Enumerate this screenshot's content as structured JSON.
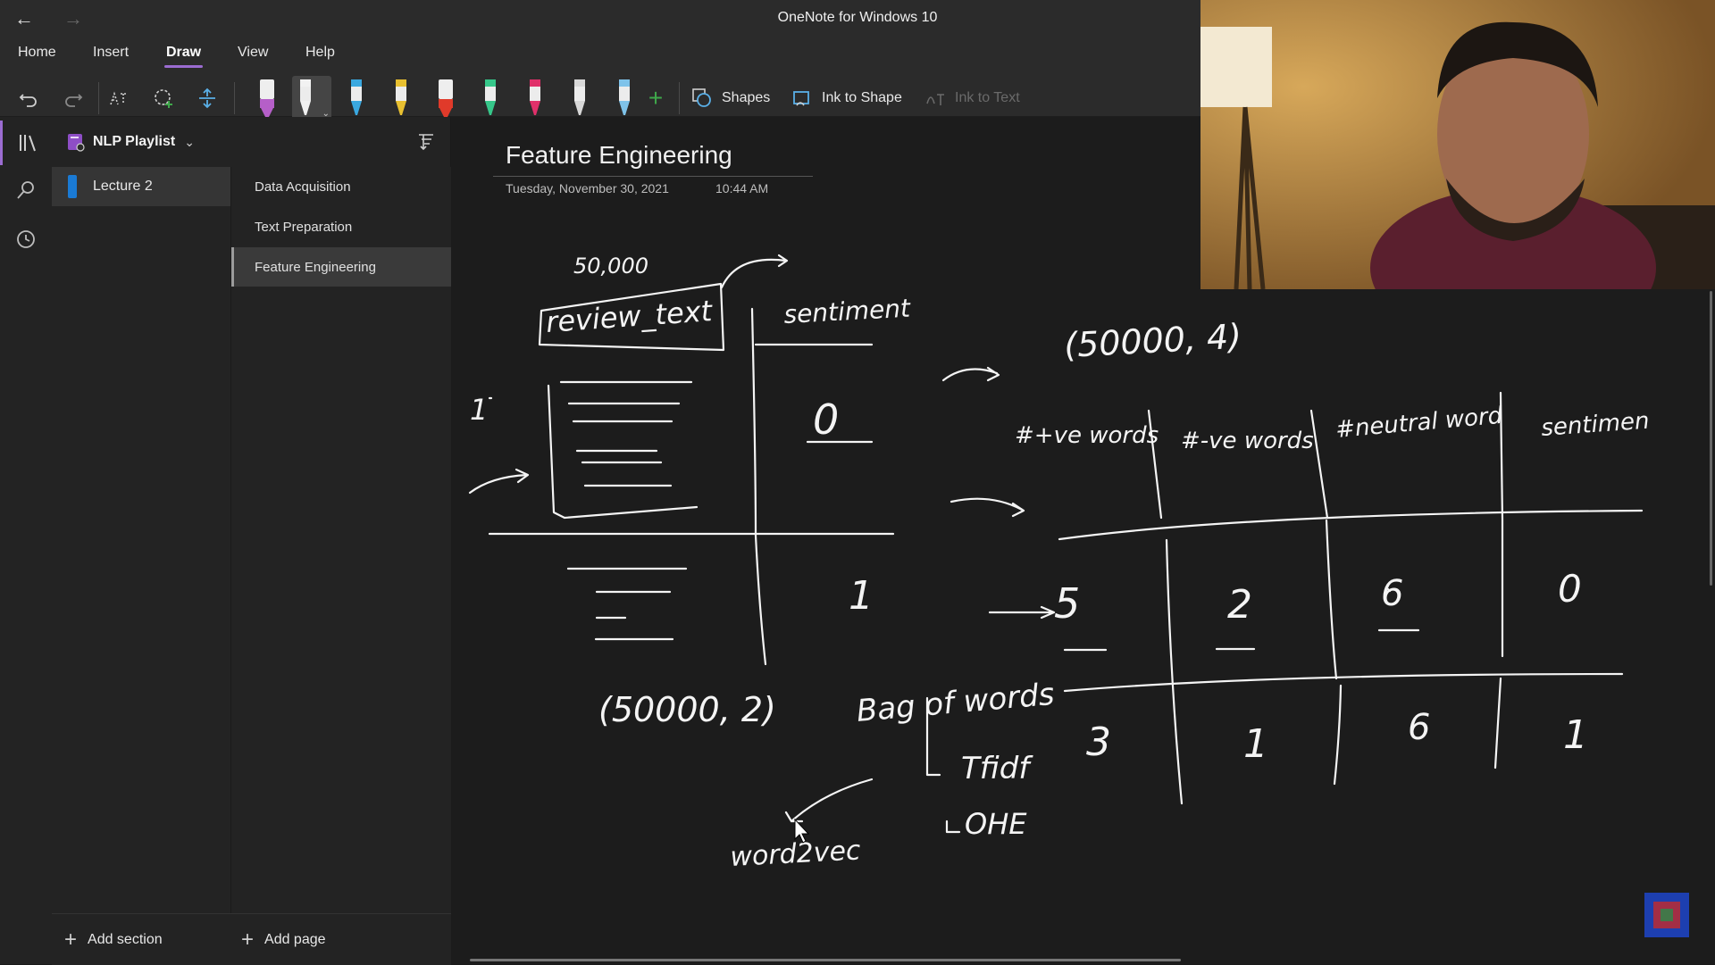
{
  "app": {
    "title": "OneNote for Windows 10"
  },
  "menu": {
    "tabs": [
      "Home",
      "Insert",
      "Draw",
      "View",
      "Help"
    ],
    "active_tab": "Draw"
  },
  "ribbon": {
    "shapes_label": "Shapes",
    "ink_to_shape_label": "Ink to Shape",
    "ink_to_text_label": "Ink to Text",
    "pen_colors": [
      "#b55fc8",
      "#f2f2f2",
      "#3aa8e0",
      "#e8c030",
      "#e03a2a",
      "#36c78a",
      "#e0306a",
      "#d8d8d8",
      "#7fc3ea"
    ],
    "add_pen_color": "#3fa84b"
  },
  "notebook": {
    "name": "NLP Playlist",
    "sections": [
      {
        "label": "Lecture 2",
        "color": "#1a7ad4"
      }
    ],
    "pages": [
      "Data Acquisition",
      "Text Preparation",
      "Feature Engineering"
    ],
    "active_page": "Feature Engineering",
    "add_section_label": "Add section",
    "add_page_label": "Add page"
  },
  "page": {
    "title": "Feature Engineering",
    "date": "Tuesday, November 30, 2021",
    "time": "10:44 AM"
  },
  "ink": {
    "count_label": "50,000",
    "col_review": "review_text",
    "col_sentiment": "sentiment",
    "row1_index": "1",
    "row1_sentiment": "0",
    "row2_sentiment": "1",
    "shape_original": "(50000, 2)",
    "shape_new": "(50000, 4)",
    "feat_headers": [
      "#+ve words",
      "#-ve words",
      "#neutral word",
      "sentimen"
    ],
    "feat_row1": [
      "5",
      "2",
      "6",
      "0"
    ],
    "feat_row2": [
      "3",
      "1",
      "6",
      "1"
    ],
    "bag_of_words": "Bag of words",
    "tfidf": "Tfidf",
    "ohe": "OHE",
    "word2vec": "word2vec"
  },
  "icons": {
    "back": "back-arrow-icon",
    "forward": "forward-arrow-icon",
    "undo": "undo-icon",
    "redo": "redo-icon",
    "lasso": "lasso-select-icon",
    "eraser": "eraser-icon",
    "add_space": "add-space-icon",
    "shapes": "shapes-icon",
    "ink_to_shape": "ink-to-shape-icon",
    "ink_to_text": "ink-to-text-icon",
    "notebooks": "notebooks-icon",
    "search": "search-icon",
    "recent": "recent-icon",
    "sort": "sort-pages-icon"
  }
}
